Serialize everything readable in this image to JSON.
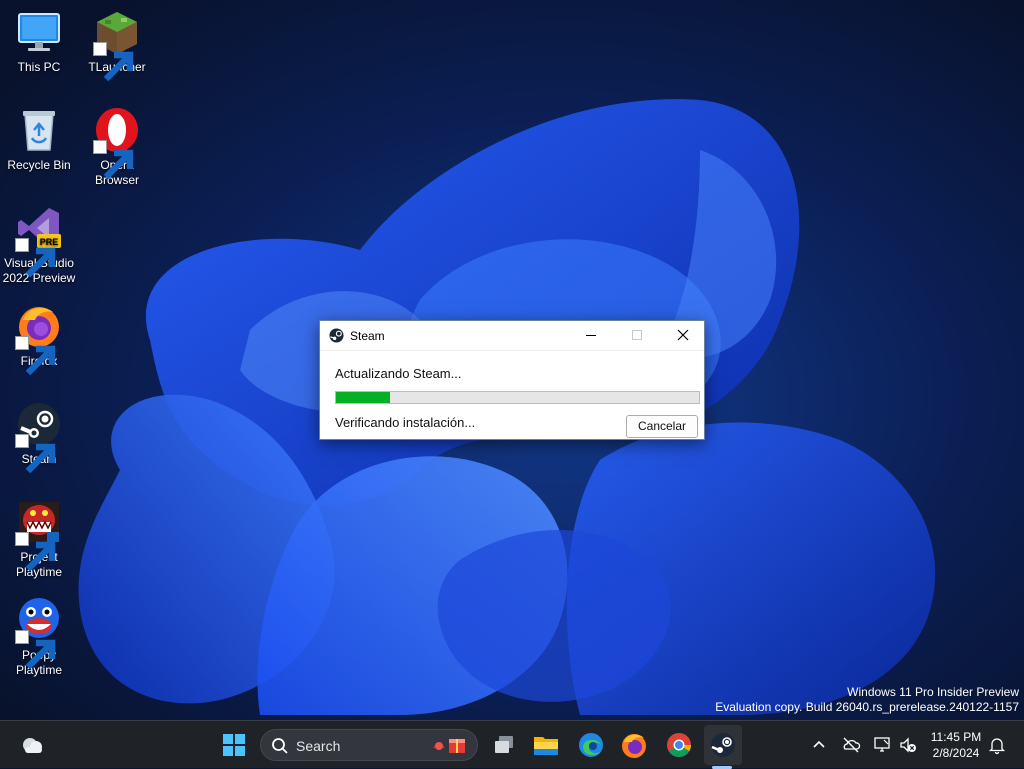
{
  "desktop": {
    "icons": [
      {
        "label": "This PC",
        "icon": "computer-icon"
      },
      {
        "label": "TLauncher",
        "icon": "tlauncher-icon"
      },
      {
        "label": "Recycle Bin",
        "icon": "recycle-bin-icon"
      },
      {
        "label": "Opera Browser",
        "icon": "opera-icon"
      },
      {
        "label": "Visual Studio 2022 Preview",
        "icon": "visual-studio-icon",
        "badge": "PRE"
      },
      {
        "label": "Firefox",
        "icon": "firefox-icon"
      },
      {
        "label": "Steam",
        "icon": "steam-icon"
      },
      {
        "label": "Project Playtime",
        "icon": "project-playtime-icon"
      },
      {
        "label": "Poppy Playtime",
        "icon": "poppy-playtime-icon"
      }
    ]
  },
  "dialog": {
    "title": "Steam",
    "status": "Actualizando Steam...",
    "progress": 0.15,
    "substatus": "Verificando instalación...",
    "cancel_label": "Cancelar"
  },
  "watermark": {
    "line1": "Windows 11 Pro Insider Preview",
    "line2": "Evaluation copy. Build 26040.rs_prerelease.240122-1157"
  },
  "taskbar": {
    "search_placeholder": "Search",
    "time": "11:45 PM",
    "date": "2/8/2024",
    "pinned": [
      "start-icon",
      "task-view-icon",
      "file-explorer-icon",
      "edge-icon",
      "firefox-icon",
      "chrome-icon",
      "steam-icon"
    ]
  },
  "colors": {
    "progress_green": "#06b025",
    "taskbar_bg": "#1f2328"
  }
}
